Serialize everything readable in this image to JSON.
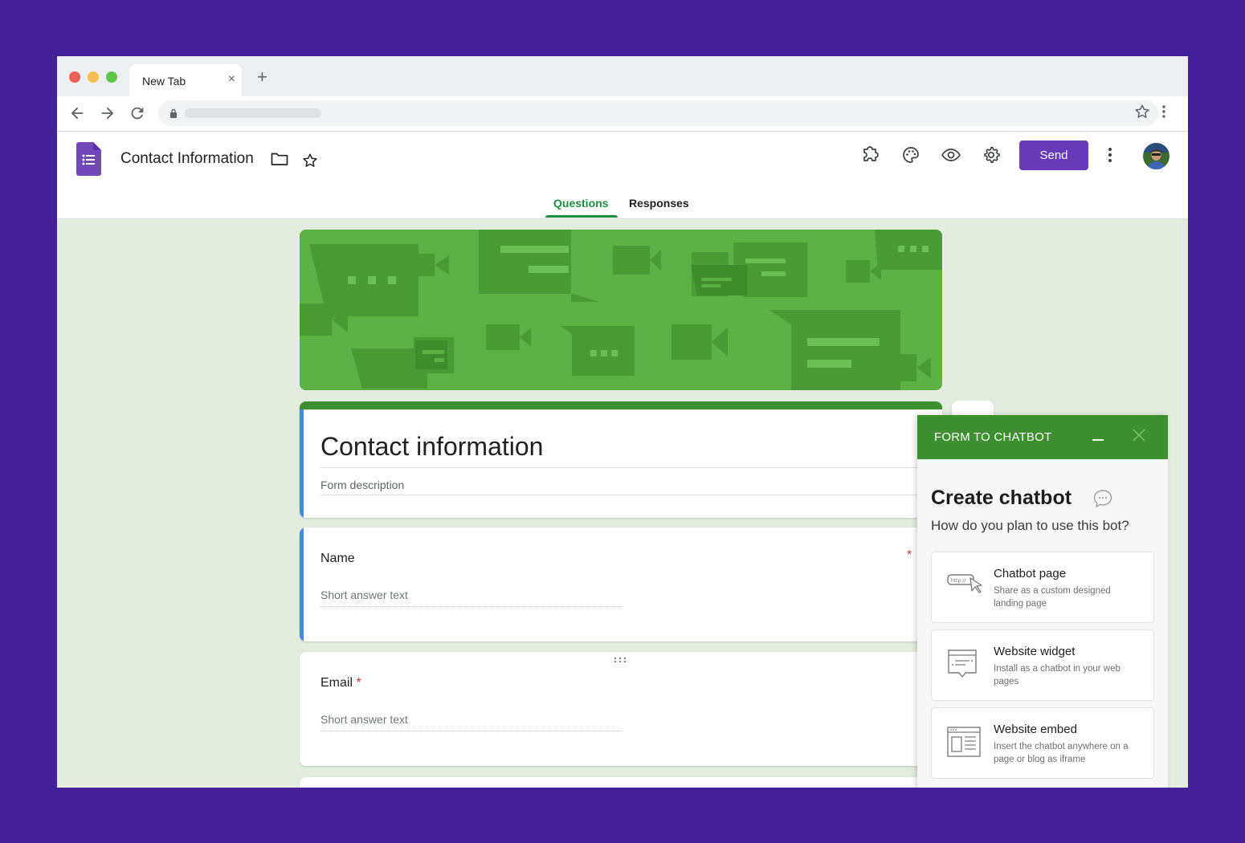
{
  "browser": {
    "tab_title": "New Tab",
    "tab_close": "×",
    "new_tab": "+"
  },
  "app": {
    "doc_title": "Contact Information",
    "send_label": "Send",
    "tabs": [
      {
        "label": "Questions",
        "active": true
      },
      {
        "label": "Responses",
        "active": false
      }
    ],
    "accent_color": "#673ab7",
    "theme_color": "#3d8f2f"
  },
  "form": {
    "title": "Contact information",
    "description_placeholder": "Form description",
    "questions": [
      {
        "label": "Name",
        "required_marker": "*",
        "answer_placeholder": "Short answer text"
      },
      {
        "label": "Email",
        "required_marker": "*",
        "answer_placeholder": "Short answer text"
      }
    ]
  },
  "chatbot_panel": {
    "header_title": "FORM TO CHATBOT",
    "heading": "Create chatbot",
    "subheading": "How do you plan to use this bot?",
    "options": [
      {
        "title": "Chatbot page",
        "description": "Share as a custom designed landing page",
        "icon": "link-cursor-icon"
      },
      {
        "title": "Website widget",
        "description": "Install as a chatbot in your web pages",
        "icon": "chat-widget-icon"
      },
      {
        "title": "Website embed",
        "description": "Insert the chatbot anywhere on a page or blog as iframe",
        "icon": "embed-layout-icon"
      }
    ]
  }
}
